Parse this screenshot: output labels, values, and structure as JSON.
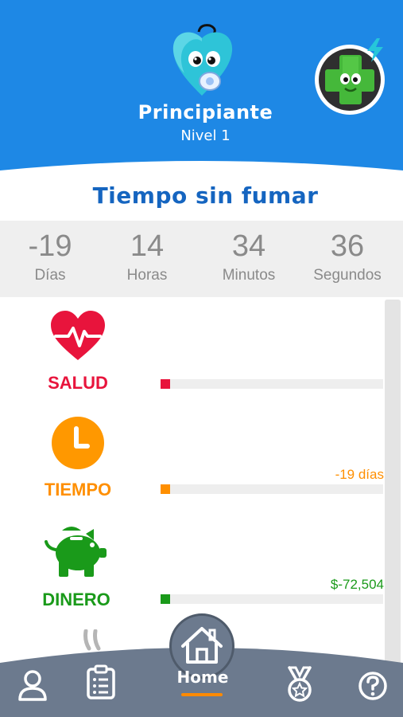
{
  "header": {
    "level_title": "Principiante",
    "level_subtitle": "Nivel 1",
    "mascot": "pacifier-heart-mascot",
    "avatar": "green-cross-character",
    "bg_color": "#1e88e5"
  },
  "section_title": "Tiempo sin fumar",
  "timer": [
    {
      "value": "-19",
      "unit": "Días"
    },
    {
      "value": "14",
      "unit": "Horas"
    },
    {
      "value": "34",
      "unit": "Minutos"
    },
    {
      "value": "36",
      "unit": "Segundos"
    }
  ],
  "stats": {
    "health": {
      "label": "SALUD",
      "icon": "heart-pulse-icon",
      "color": "#e8143c",
      "value": "",
      "progress": 0.0
    },
    "time": {
      "label": "TIEMPO",
      "icon": "clock-icon",
      "color": "#ff8f00",
      "value": "-19 días",
      "progress": 0.0
    },
    "money": {
      "label": "DINERO",
      "icon": "piggy-bank-icon",
      "color": "#1a9a1a",
      "value": "$-72,504",
      "progress": 0.0
    }
  },
  "nav": {
    "home_label": "Home",
    "items": [
      "profile-icon",
      "clipboard-icon",
      "home-icon",
      "medal-icon",
      "help-icon"
    ],
    "bg_color": "#6c7a8e",
    "accent": "#ff8a00"
  }
}
